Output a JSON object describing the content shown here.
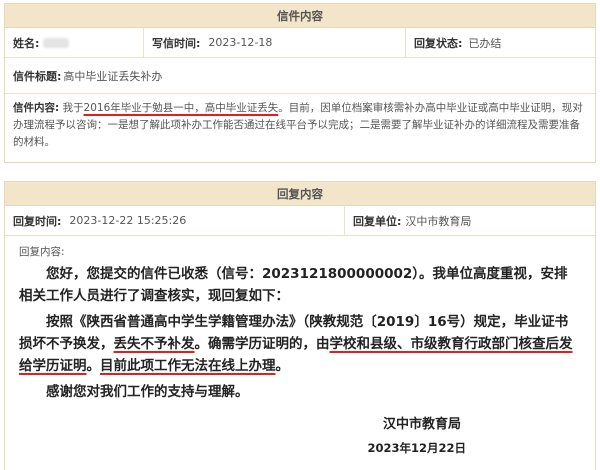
{
  "letter": {
    "header": "信件内容",
    "name_label": "姓名:",
    "write_time_label": "写信时间:",
    "write_time": "2023-12-18",
    "reply_status_label": "回复状态:",
    "reply_status": "已办结",
    "title_label": "信件标题:",
    "title": "高中毕业证丢失补办",
    "content_label": "信件内容:",
    "content_pre": "我于",
    "content_u1": "2016年毕业于勉县一中，高中毕业证丢失",
    "content_rest": "。目前，因单位档案审核需补办高中毕业证或高中毕业证明，现对办理流程予以咨询：一是想了解此项补办工作能否通过在线平台予以完成；二是需要了解毕业证补办的详细流程及需要准备的材料。"
  },
  "reply": {
    "header": "回复内容",
    "time_label": "回复时间:",
    "time": "2023-12-22 15:25:26",
    "unit_label": "回复单位:",
    "unit": "汉中市教育局",
    "content_label": "回复内容:",
    "p1": "您好，您提交的信件已收悉（信号：2023121800000002）。我单位高度重视，安排相关工作人员进行了调查核实，现回复如下：",
    "p2_a": "按照《陕西省普通高中学生学籍管理办法》（陕教规范〔2019〕16号）规定，毕业证书损坏不予换发，",
    "p2_u1": "丢失不予补发",
    "p2_b": "。确需学历证明的，由",
    "p2_u2": "学校和县级、市级教育行政部门核查后发给学历证明",
    "p2_c": "。",
    "p2_u3": "目前此项工作无法在线上办理",
    "p2_d": "。",
    "p3": "感谢您对我们工作的支持与理解。",
    "signature": "汉中市教育局",
    "date": "2023年12月22日"
  },
  "colors": {
    "header_bg": "#f3e5c9",
    "border": "#e6d8bc",
    "annotation_red": "#e02020"
  }
}
